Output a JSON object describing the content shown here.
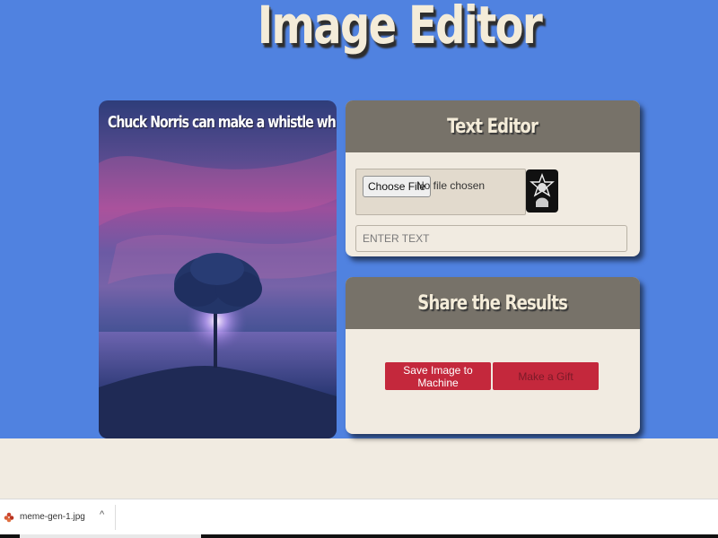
{
  "app": {
    "title": "Image Editor"
  },
  "meme": {
    "caption": "Chuck Norris can make a whistle whistle"
  },
  "text_editor": {
    "heading": "Text Editor",
    "file_button_label": "Choose File",
    "file_status": "No file chosen",
    "text_placeholder": "ENTER TEXT"
  },
  "share": {
    "heading": "Share the Results",
    "save_label": "Save Image to Machine",
    "gift_label": "Make a Gift"
  },
  "download": {
    "filename": "meme-gen-1.jpg",
    "chevron": "^"
  },
  "colors": {
    "page_blue": "#5082e0",
    "cream": "#f1ebe1",
    "card_header": "#777269",
    "button_red": "#c4283c"
  }
}
